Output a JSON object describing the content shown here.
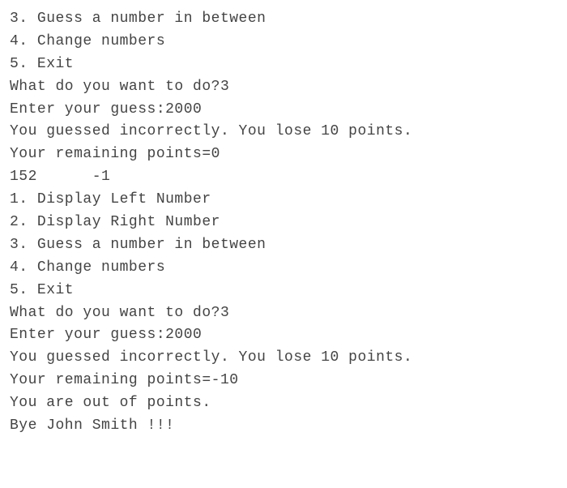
{
  "lines": {
    "l0": "3. Guess a number in between",
    "l1": "4. Change numbers",
    "l2": "5. Exit",
    "l3": "What do you want to do?3",
    "l4": "Enter your guess:2000",
    "l5": "You guessed incorrectly. You lose 10 points.",
    "l6": "Your remaining points=0",
    "l7": "152      -1",
    "l8": "1. Display Left Number",
    "l9": "2. Display Right Number",
    "l10": "3. Guess a number in between",
    "l11": "4. Change numbers",
    "l12": "5. Exit",
    "l13": "What do you want to do?3",
    "l14": "Enter your guess:2000",
    "l15": "You guessed incorrectly. You lose 10 points.",
    "l16": "Your remaining points=-10",
    "l17": "You are out of points.",
    "l18": "Bye John Smith !!!"
  }
}
